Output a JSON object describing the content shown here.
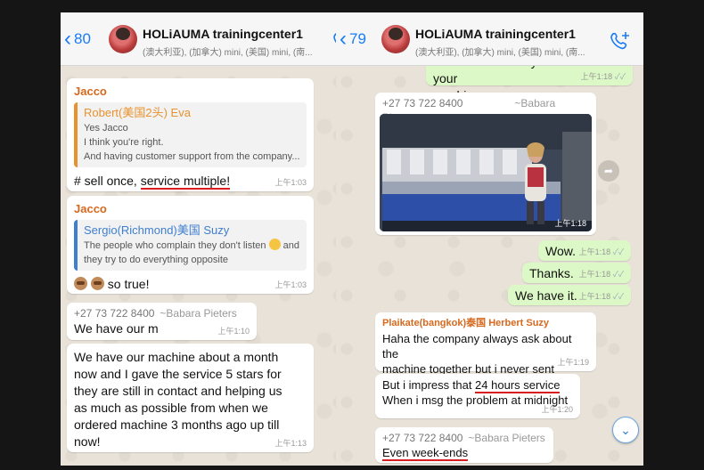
{
  "left_chat": {
    "back_count": "80",
    "group_name": "HOLiAUMA trainingcenter1",
    "members": "(澳大利亚), (加拿大) mini, (美国) mini, (南...",
    "msg1": {
      "sender": "Jacco",
      "quote_name": "Robert(美国2头) Eva",
      "quote_lines": [
        "Yes Jacco",
        "I think you're right.",
        "And having customer support from the company..."
      ],
      "text_prefix": "# sell once, ",
      "text_highlight": "service multiple!",
      "time": "上午1:03"
    },
    "msg2": {
      "sender": "Jacco",
      "quote_name": "Sergio(Richmond)美国 Suzy",
      "quote_line1": "The people who complain they don't listen",
      "quote_line1_end": "and",
      "quote_line2": "they try to do everything opposite",
      "text": "so true!",
      "time": "上午1:03"
    },
    "msg3": {
      "phone": "+27 73 722 8400",
      "alias": "~Babara Pieters",
      "text": "We have our m",
      "time": "上午1:10"
    },
    "msg4": {
      "lines": [
        "We have our machine about a month",
        "now and I gave the service 5 stars for",
        "they are still in contact and helping us",
        "as much as possible from when we",
        "ordered machine 3 months ago up till",
        "now!"
      ],
      "time": "上午1:13"
    }
  },
  "right_chat": {
    "back_count": "79",
    "group_name": "HOLiAUMA trainingcenter1",
    "members": "(澳大利亚), (加拿大) mini, (美国) mini, (南...",
    "msg_top": {
      "lines": [
        "Let us remember your face and your",
        "machine."
      ],
      "time": "上午1:18"
    },
    "photo_msg": {
      "phone": "+27 73 722 8400",
      "alias": "~Babara Pieters",
      "time": "上午1:18"
    },
    "out_msgs": [
      {
        "text": "Wow.",
        "time": "上午1:18"
      },
      {
        "text": "Thanks.",
        "time": "上午1:18"
      },
      {
        "text": "We have it.",
        "time": "上午1:18"
      }
    ],
    "msg_herbert": {
      "sender": "Plaikate(bangkok)泰国 Herbert  Suzy",
      "lines": [
        "Haha the company always ask about the",
        "machine together but i never sent"
      ],
      "time": "上午1:19"
    },
    "msg_24h": {
      "prefix": "But i impress that ",
      "highlight": "24 hours service",
      "line2": "When i msg the problem at midnight",
      "time": "上午1:20"
    },
    "msg_weekends": {
      "phone": "+27 73 722 8400",
      "alias": "~Babara Pieters",
      "text": "Even week-ends"
    }
  },
  "colors": {
    "accent_blue": "#1a7cf5",
    "sender_orange": "#d7691f",
    "highlight_red": "#d81e1e",
    "outgoing_green": "#dcf8c6"
  }
}
